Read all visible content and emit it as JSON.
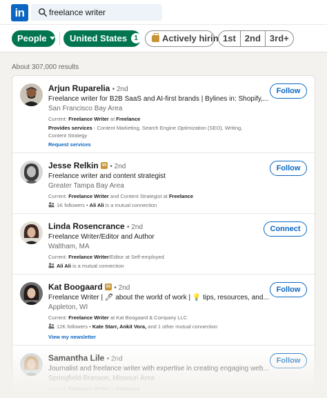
{
  "header": {
    "logo_text": "in",
    "search_value": "freelance writer"
  },
  "filters": {
    "people": "People",
    "location": "United States",
    "location_count": "1",
    "hiring": "Actively hiring",
    "conn_1st": "1st",
    "conn_2nd": "2nd",
    "conn_3rd": "3rd+"
  },
  "results_count": "About 307,000 results",
  "results": [
    {
      "name": "Arjun Ruparelia",
      "degree": "• 2nd",
      "headline": "Freelance writer for B2B SaaS and AI-first brands | Bylines in: Shopify,...",
      "location": "San Francisco Bay Area",
      "current_prefix": "Current: ",
      "current_role": "Freelance Writer",
      "current_mid": " at ",
      "current_company": "Freelance",
      "services_prefix": "Provides services",
      "services_line1": " - Content Marketing, Search Engine Optimization (SEO), Writing,",
      "services_line2": "Content Strategy",
      "link": "Request services",
      "action": "Follow"
    },
    {
      "name": "Jesse Relkin",
      "in_badge": "in",
      "degree": "• 2nd",
      "headline": "Freelance writer and content strategist",
      "location": "Greater Tampa Bay Area",
      "current_prefix": "Current: ",
      "current_role": "Freelance Writer",
      "current_mid": " and Content Strategist at ",
      "current_company": "Freelance",
      "followers": "1K followers",
      "mutual_sep": " • ",
      "mutual_name": "Ali Ali",
      "mutual_suffix": " is a mutual connection",
      "action": "Follow"
    },
    {
      "name": "Linda Rosencrance",
      "degree": "• 2nd",
      "headline": "Freelance Writer/Editor and Author",
      "location": "Waltham, MA",
      "current_prefix": "Current: ",
      "current_role": "Freelance Writer",
      "current_mid": "/Editor at Self-employed",
      "mutual_name": "Ali Ali",
      "mutual_suffix": " is a mutual connection",
      "action": "Connect"
    },
    {
      "name": "Kat Boogaard",
      "in_badge": "in",
      "degree": "• 2nd",
      "headline": "Freelance Writer | 🖊 about the world of work | 💡 tips, resources, and...",
      "location": "Appleton, WI",
      "current_prefix": "Current: ",
      "current_role": "Freelance Writer",
      "current_mid": " at Kat Boogaard & Company LLC",
      "followers": "12K followers",
      "mutual_sep": " • ",
      "mutual_name": "Kate Starr, Ankit Vora,",
      "mutual_suffix": " and 1 other mutual connection",
      "link": "View my newsletter",
      "action": "Follow"
    },
    {
      "name": "Samantha Lile",
      "degree": "• 2nd",
      "headline": "Journalist and freelance writer with expertise in creating engaging web...",
      "location": "Springfield-Branson, Missouri Area",
      "current_prefix": "Current: ",
      "current_role": "Freelance Writer",
      "current_mid": " at ",
      "current_company": "Freelance",
      "action": "Follow"
    }
  ],
  "colors": {
    "brand": "#0a66c2",
    "green_filter": "#01754f",
    "background": "#f4f2ee"
  }
}
